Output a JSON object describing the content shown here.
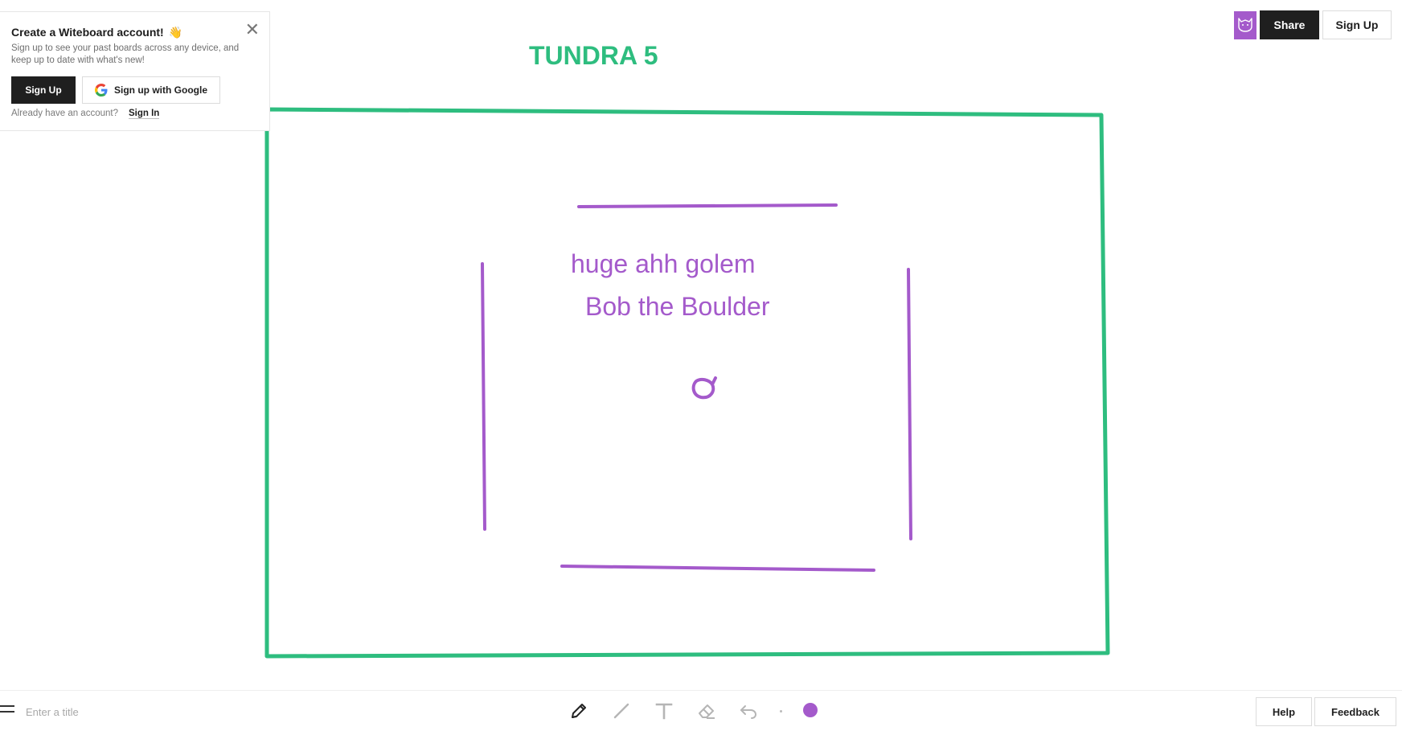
{
  "signup_popup": {
    "title": "Create a Witeboard account!",
    "wave_emoji": "👋",
    "close_glyph": "✕",
    "description": "Sign up to see your past boards across any device, and keep up to date with what's new!",
    "signup_label": "Sign Up",
    "google_label": "Sign up with Google",
    "already_text": "Already have an account?",
    "signin_label": "Sign In"
  },
  "header": {
    "share_label": "Share",
    "signup_label": "Sign Up"
  },
  "board": {
    "heading": "TUNDRA 5",
    "text_line_1": "huge ahh golem",
    "text_line_2": "Bob the Boulder"
  },
  "bottom_bar": {
    "title_placeholder": "Enter a title",
    "help_label": "Help",
    "feedback_label": "Feedback"
  },
  "colors": {
    "pen_color": "#a45acb",
    "board_frame_color": "#2ebd7f",
    "button_dark": "#1f1f1f"
  },
  "icons": [
    "menu-icon",
    "pen-icon",
    "line-icon",
    "text-icon",
    "eraser-icon",
    "undo-icon",
    "google-icon",
    "avatar-icon",
    "close-icon"
  ]
}
